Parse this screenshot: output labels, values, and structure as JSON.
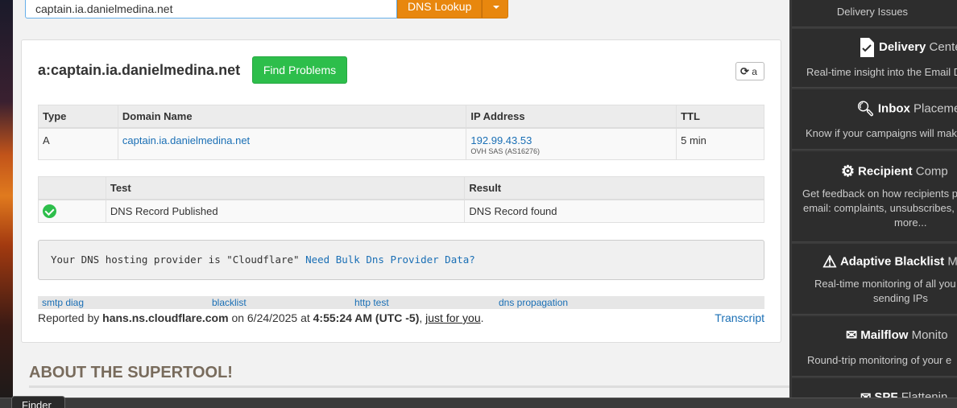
{
  "search": {
    "value": "captain.ia.danielmedina.net",
    "button_label": "DNS Lookup"
  },
  "panel": {
    "title": "a:captain.ia.danielmedina.net",
    "find_problems_label": "Find Problems",
    "refresh_label": "a"
  },
  "records_table": {
    "headers": [
      "Type",
      "Domain Name",
      "IP Address",
      "TTL"
    ],
    "rows": [
      {
        "type": "A",
        "domain": "captain.ia.danielmedina.net",
        "ip": "192.99.43.53",
        "asn": "OVH SAS (AS16276)",
        "ttl": "5 min"
      }
    ]
  },
  "tests_table": {
    "headers": [
      "",
      "Test",
      "Result"
    ],
    "rows": [
      {
        "status": "pass",
        "test": "DNS Record Published",
        "result": "DNS Record found"
      }
    ]
  },
  "provider": {
    "text": "Your DNS hosting provider is \"Cloudflare\"",
    "link": "Need Bulk Dns Provider Data?"
  },
  "quick_links": [
    "smtp diag",
    "blacklist",
    "http test",
    "dns propagation"
  ],
  "reported": {
    "prefix": "Reported by",
    "server": "hans.ns.cloudflare.com",
    "on": "on 6/24/2025 at",
    "time": "4:55:24 AM (UTC -5)",
    "comma": ",",
    "just_for_you": "just for you",
    "period": ".",
    "transcript": "Transcript"
  },
  "about_heading": "ABOUT THE SUPERTOOL!",
  "sidebar": {
    "items": [
      {
        "title": "",
        "desc": "Delivery Issues"
      },
      {
        "title": "Delivery",
        "title_thin": "Cente",
        "desc": "Real-time insight into the Email D"
      },
      {
        "title": "Inbox",
        "title_thin": "Placemer",
        "desc": "Know if your campaigns will mak"
      },
      {
        "title": "Recipient",
        "title_thin": "Comp",
        "desc_lines": [
          "Get feedback on how recipients p",
          "email: complaints, unsubscribes,",
          "more..."
        ]
      },
      {
        "title": "Adaptive Blacklist",
        "title_thin": "M",
        "desc_lines": [
          "Real-time monitoring of all you",
          "sending IPs"
        ]
      },
      {
        "title": "Mailflow",
        "title_thin": "Monito",
        "desc": "Round-trip monitoring of your e"
      },
      {
        "title": "SPF",
        "title_thin": "Flattenin"
      }
    ]
  },
  "taskbar": {
    "finder_label": "Finder"
  },
  "colors": {
    "accent_orange": "#e8870e",
    "success_green": "#2dbe4b",
    "link_blue": "#1a6fb5"
  }
}
